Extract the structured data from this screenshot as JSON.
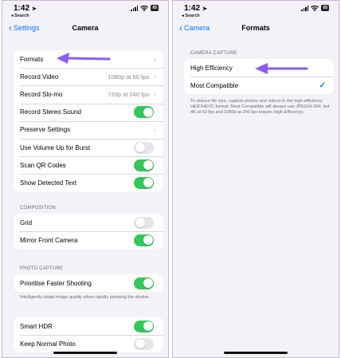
{
  "colors": {
    "accent": "#007aff",
    "toggle_on": "#34c759",
    "arrow": "#8b5cf6"
  },
  "left": {
    "status": {
      "time": "1:42",
      "back_app": "◂ Search",
      "battery": "65"
    },
    "nav": {
      "back_label": "Settings",
      "title": "Camera"
    },
    "main_rows": [
      {
        "label": "Formats",
        "value": "",
        "control": "chevron"
      },
      {
        "label": "Record Video",
        "value": "1080p at 60 fps",
        "control": "chevron"
      },
      {
        "label": "Record Slo-mo",
        "value": "720p at 240 fps",
        "control": "chevron"
      },
      {
        "label": "Record Stereo Sound",
        "control": "toggle",
        "on": true
      },
      {
        "label": "Preserve Settings",
        "value": "",
        "control": "chevron"
      },
      {
        "label": "Use Volume Up for Burst",
        "control": "toggle",
        "on": false
      },
      {
        "label": "Scan QR Codes",
        "control": "toggle",
        "on": true
      },
      {
        "label": "Show Detected Text",
        "control": "toggle",
        "on": true
      }
    ],
    "composition": {
      "header": "COMPOSITION",
      "rows": [
        {
          "label": "Grid",
          "control": "toggle",
          "on": false
        },
        {
          "label": "Mirror Front Camera",
          "control": "toggle",
          "on": true
        }
      ]
    },
    "photo_capture": {
      "header": "PHOTO CAPTURE",
      "rows": [
        {
          "label": "Prioritise Faster Shooting",
          "control": "toggle",
          "on": true
        }
      ],
      "note": "Intelligently adapt image quality when rapidly pressing the shutter."
    },
    "hdr": {
      "rows": [
        {
          "label": "Smart HDR",
          "control": "toggle",
          "on": true
        },
        {
          "label": "Keep Normal Photo",
          "control": "toggle",
          "on": false
        }
      ]
    }
  },
  "right": {
    "status": {
      "time": "1:42",
      "back_app": "◂ Search",
      "battery": "65"
    },
    "nav": {
      "back_label": "Camera",
      "title": "Formats"
    },
    "capture": {
      "header": "CAMERA CAPTURE",
      "options": [
        {
          "label": "High Efficiency",
          "selected": false
        },
        {
          "label": "Most Compatible",
          "selected": true
        }
      ],
      "note": "To reduce file size, capture photos and videos in the high-efficiency HEIF/HEVC format. Most Compatible will always use JPEG/H.264, but 4K at 60 fps and 1080p at 240 fps require High Efficiency."
    }
  }
}
